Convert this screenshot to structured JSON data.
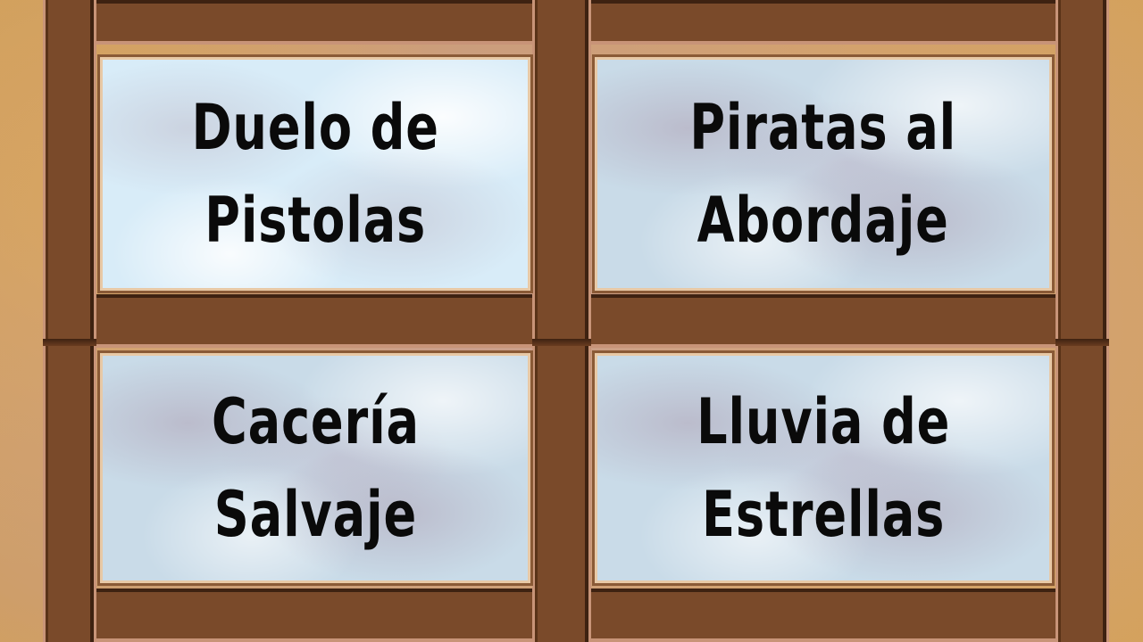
{
  "menu": {
    "options": [
      {
        "id": "duelo",
        "line1": "Duelo de",
        "line2": "Pistolas",
        "highlighted": true
      },
      {
        "id": "piratas",
        "line1": "Piratas al",
        "line2": "Abordaje",
        "highlighted": false
      },
      {
        "id": "caceria",
        "line1": "Cacería",
        "line2": "Salvaje",
        "highlighted": false
      },
      {
        "id": "lluvia",
        "line1": "Lluvia de",
        "line2": "Estrellas",
        "highlighted": false
      }
    ]
  },
  "colors": {
    "wood": "#7a4a2a",
    "wood_dark": "#3e2211",
    "wood_light": "#c89478",
    "glass": "#c9dbe8",
    "text": "#0a0a0a"
  }
}
